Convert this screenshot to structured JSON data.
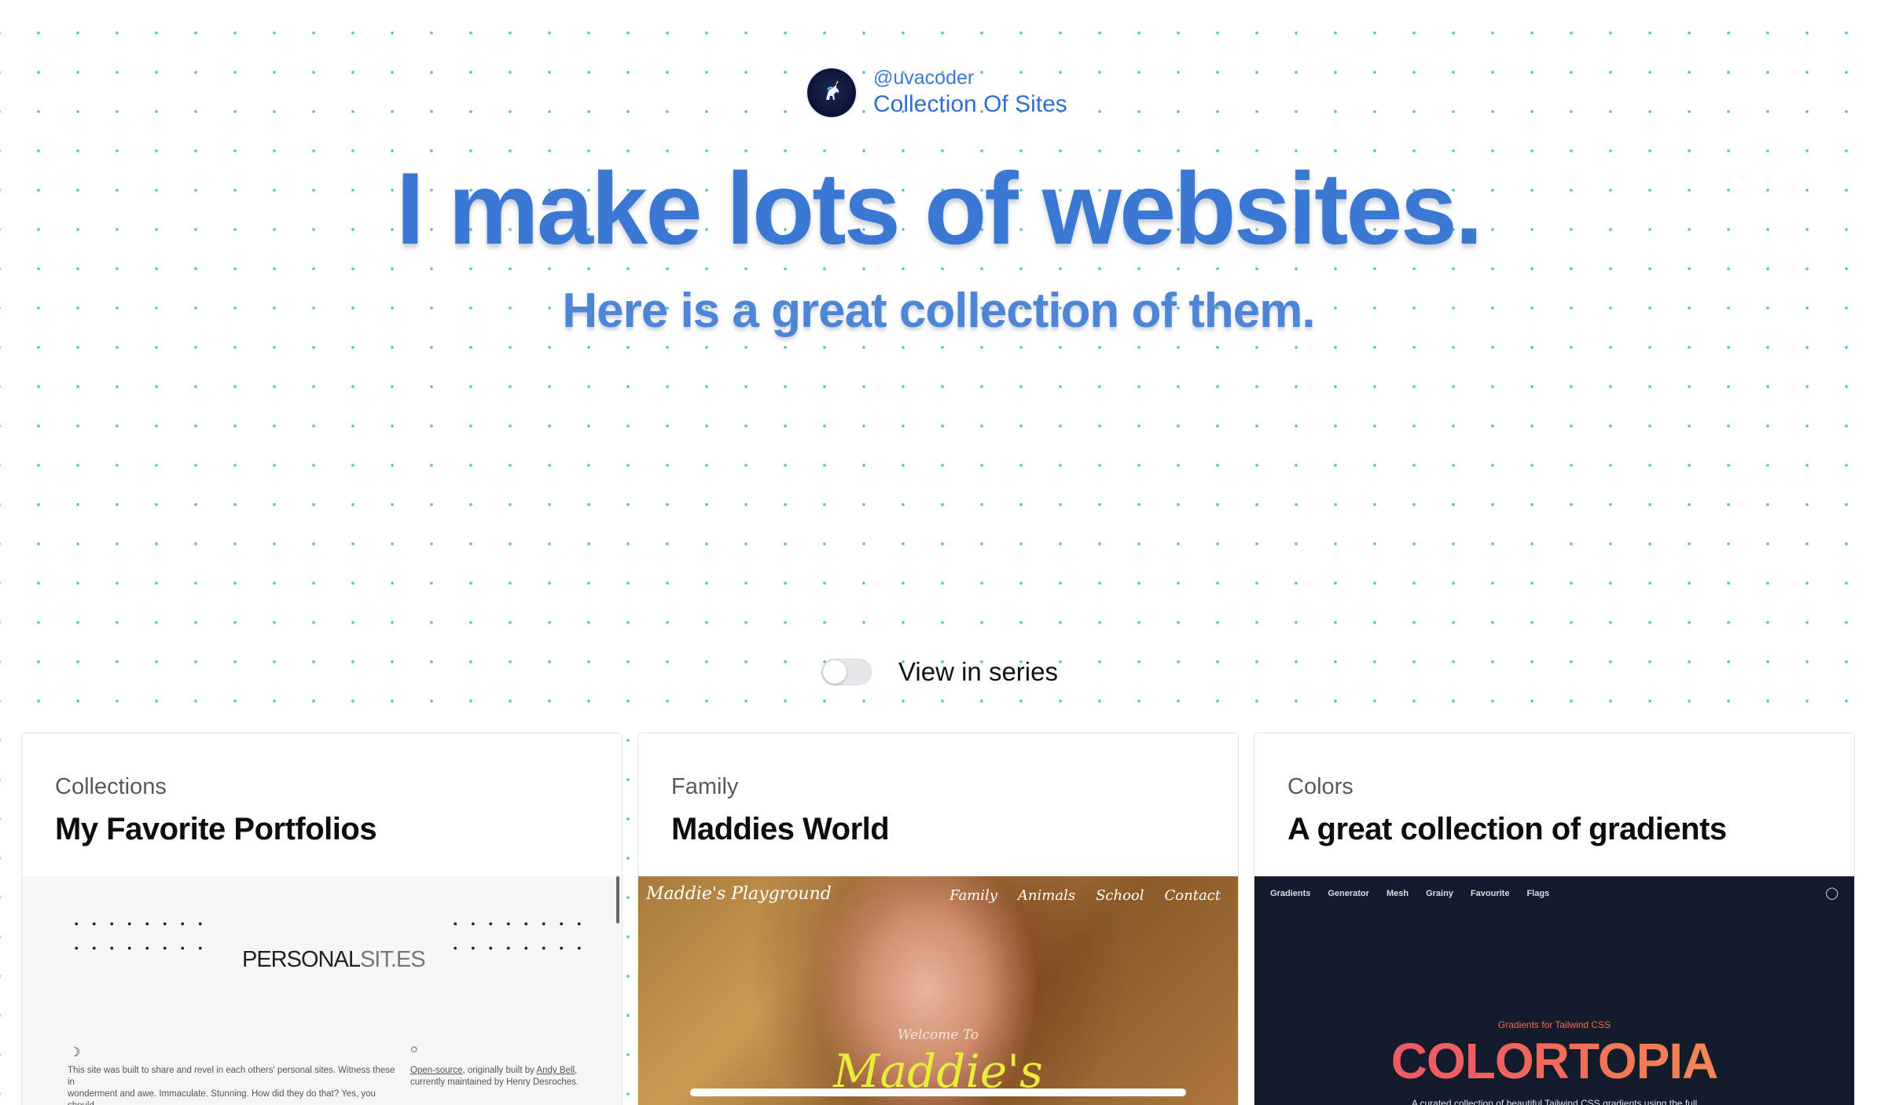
{
  "header": {
    "handle": "@uvacoder",
    "collection_link": "Collection Of Sites",
    "headline": "I make lots of websites.",
    "subheadline": "Here is a great collection of them."
  },
  "view_toggle": {
    "label": "View in series",
    "enabled": false
  },
  "cards": [
    {
      "category": "Collections",
      "title": "My Favorite Portfolios",
      "preview": {
        "logo_bold": "PERSONAL",
        "logo_thin": "SIT.ES",
        "left_text_1": "This site was built to share and revel in each others' personal sites. Witness these in",
        "left_text_2": "wonderment and awe. Immaculate. Stunning. How did they do that? Yes, you should",
        "right_link_1": "Open-source",
        "right_text_1": ", originally built by ",
        "right_link_2": "Andy Bell",
        "right_text_2": ",",
        "right_text_3": "currently maintained by Henry Desroches."
      }
    },
    {
      "category": "Family",
      "title": "Maddies World",
      "preview": {
        "brand": "Maddie's Playground",
        "nav": [
          "Family",
          "Animals",
          "School",
          "Contact"
        ],
        "welcome": "Welcome To",
        "big_text": "Maddie's"
      }
    },
    {
      "category": "Colors",
      "title": "A great collection of gradients",
      "preview": {
        "nav": [
          "Gradients",
          "Generator",
          "Mesh",
          "Grainy",
          "Favourite",
          "Flags"
        ],
        "tagline": "Gradients for Tailwind CSS",
        "title": "COLORTOPIA",
        "description": "A curated collection of beautiful Tailwind CSS gradients using the full"
      }
    }
  ],
  "colors": {
    "accent": "#3b78d3",
    "dot_grid": "#5ec9b0",
    "colortopia_bg": "#141c2b"
  }
}
